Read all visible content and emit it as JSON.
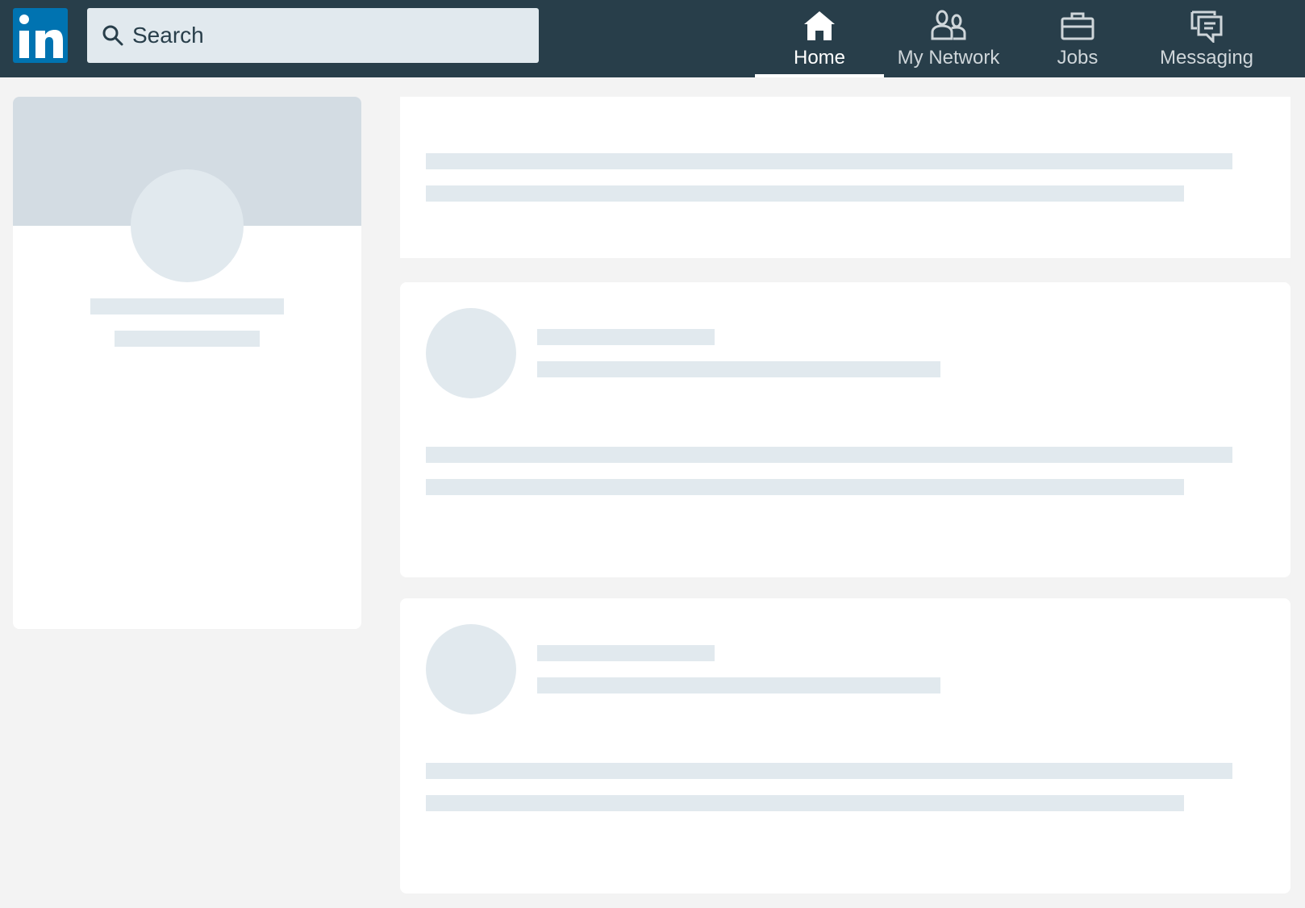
{
  "header": {
    "logo": {
      "text": "in",
      "color": "#0073b1",
      "icon": "linkedin-logo"
    },
    "search": {
      "placeholder": "Search",
      "value": "",
      "icon": "search-icon"
    },
    "nav": [
      {
        "label": "Home",
        "icon": "home-icon",
        "active": true
      },
      {
        "label": "My Network",
        "icon": "people-icon",
        "active": false
      },
      {
        "label": "Jobs",
        "icon": "briefcase-icon",
        "active": false
      },
      {
        "label": "Messaging",
        "icon": "messaging-icon",
        "active": false
      }
    ]
  },
  "colors": {
    "header_bg": "#283e4a",
    "page_bg": "#f3f3f3",
    "card_bg": "#ffffff",
    "placeholder": "#e1e9ee",
    "profile_banner": "#d3dce3",
    "brand": "#0073b1"
  },
  "state": "loading-skeleton"
}
